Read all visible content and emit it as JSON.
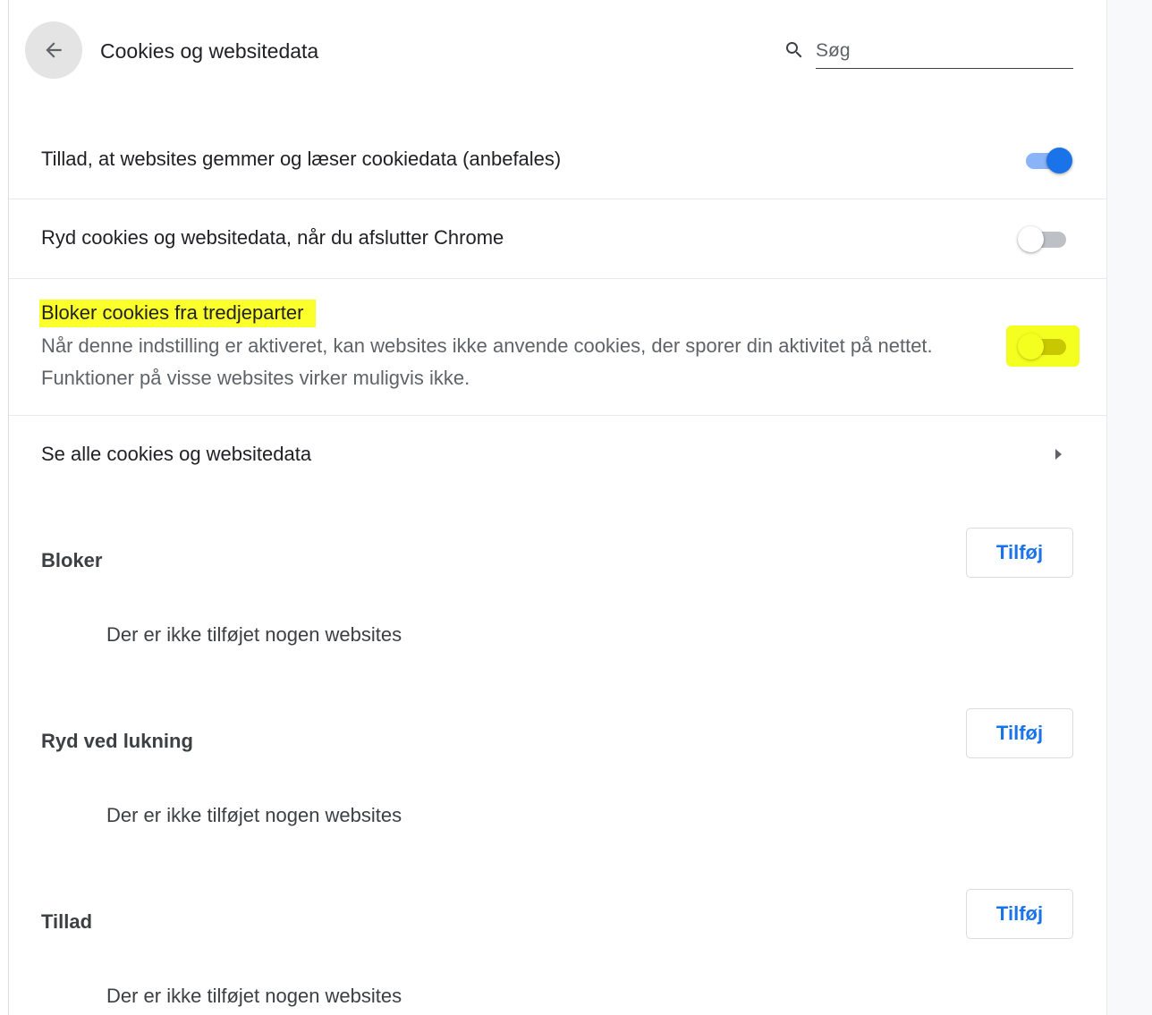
{
  "header": {
    "title": "Cookies og websitedata",
    "search_placeholder": "Søg"
  },
  "settings": [
    {
      "label": "Tillad, at websites gemmer og læser cookiedata (anbefales)",
      "enabled": true
    },
    {
      "label": "Ryd cookies og websitedata, når du afslutter Chrome",
      "enabled": false
    },
    {
      "label": "Bloker cookies fra tredjeparter",
      "description_line1": "Når denne indstilling er aktiveret, kan websites ikke anvende cookies, der sporer din aktivitet på nettet.",
      "description_line2": "Funktioner på visse websites virker muligvis ikke.",
      "enabled": false,
      "highlight_color": "#fbff2a"
    }
  ],
  "see_all": {
    "label": "Se alle cookies og websitedata"
  },
  "sections": [
    {
      "title": "Bloker",
      "add_label": "Tilføj",
      "empty_text": "Der er ikke tilføjet nogen websites"
    },
    {
      "title": "Ryd ved lukning",
      "add_label": "Tilføj",
      "empty_text": "Der er ikke tilføjet nogen websites"
    },
    {
      "title": "Tillad",
      "add_label": "Tilføj",
      "empty_text": "Der er ikke tilføjet nogen websites"
    }
  ],
  "colors": {
    "accent": "#1a73e8",
    "toggle_on_track": "#8ab4f8",
    "toggle_off_track": "#bdc1c6",
    "highlight": "#fbff2a"
  }
}
